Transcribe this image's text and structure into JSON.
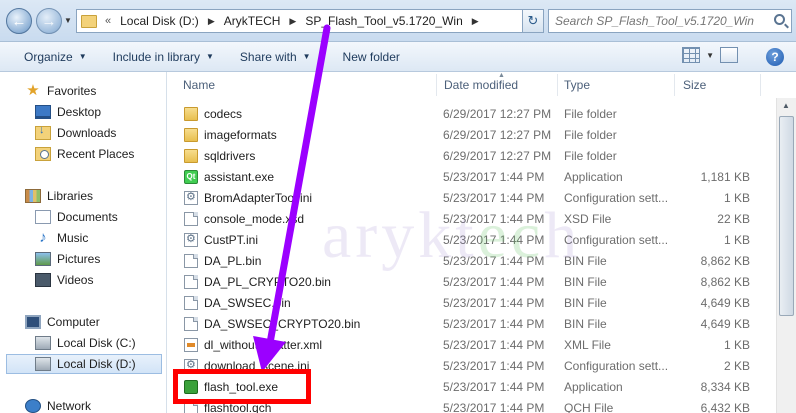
{
  "address": {
    "chevron": "«",
    "crumbs": [
      "Local Disk (D:)",
      "ArykTECH",
      "SP_Flash_Tool_v5.1720_Win"
    ]
  },
  "search": {
    "placeholder": "Search SP_Flash_Tool_v5.1720_Win"
  },
  "toolbar": {
    "organize": "Organize",
    "include": "Include in library",
    "share": "Share with",
    "new_folder": "New folder",
    "help": "?"
  },
  "nav": {
    "favorites": "Favorites",
    "desktop": "Desktop",
    "downloads": "Downloads",
    "recent": "Recent Places",
    "libraries": "Libraries",
    "documents": "Documents",
    "music": "Music",
    "pictures": "Pictures",
    "videos": "Videos",
    "computer": "Computer",
    "local_c": "Local Disk (C:)",
    "local_d": "Local Disk (D:)",
    "network": "Network"
  },
  "columns": {
    "name": "Name",
    "date": "Date modified",
    "type": "Type",
    "size": "Size"
  },
  "files": [
    {
      "name": "codecs",
      "date": "6/29/2017 12:27 PM",
      "type": "File folder",
      "size": "",
      "icon": "folder"
    },
    {
      "name": "imageformats",
      "date": "6/29/2017 12:27 PM",
      "type": "File folder",
      "size": "",
      "icon": "folder"
    },
    {
      "name": "sqldrivers",
      "date": "6/29/2017 12:27 PM",
      "type": "File folder",
      "size": "",
      "icon": "folder"
    },
    {
      "name": "assistant.exe",
      "date": "5/23/2017 1:44 PM",
      "type": "Application",
      "size": "1,181 KB",
      "icon": "qt"
    },
    {
      "name": "BromAdapterTool.ini",
      "date": "5/23/2017 1:44 PM",
      "type": "Configuration sett...",
      "size": "1 KB",
      "icon": "gear"
    },
    {
      "name": "console_mode.xsd",
      "date": "5/23/2017 1:44 PM",
      "type": "XSD File",
      "size": "22 KB",
      "icon": "doc"
    },
    {
      "name": "CustPT.ini",
      "date": "5/23/2017 1:44 PM",
      "type": "Configuration sett...",
      "size": "1 KB",
      "icon": "gear"
    },
    {
      "name": "DA_PL.bin",
      "date": "5/23/2017 1:44 PM",
      "type": "BIN File",
      "size": "8,862 KB",
      "icon": "doc"
    },
    {
      "name": "DA_PL_CRYPTO20.bin",
      "date": "5/23/2017 1:44 PM",
      "type": "BIN File",
      "size": "8,862 KB",
      "icon": "doc"
    },
    {
      "name": "DA_SWSEC.bin",
      "date": "5/23/2017 1:44 PM",
      "type": "BIN File",
      "size": "4,649 KB",
      "icon": "doc"
    },
    {
      "name": "DA_SWSEC_CRYPTO20.bin",
      "date": "5/23/2017 1:44 PM",
      "type": "BIN File",
      "size": "4,649 KB",
      "icon": "doc"
    },
    {
      "name": "dl_without_scatter.xml",
      "date": "5/23/2017 1:44 PM",
      "type": "XML File",
      "size": "1 KB",
      "icon": "xml"
    },
    {
      "name": "download_scene.ini",
      "date": "5/23/2017 1:44 PM",
      "type": "Configuration sett...",
      "size": "2 KB",
      "icon": "gear"
    },
    {
      "name": "flash_tool.exe",
      "date": "5/23/2017 1:44 PM",
      "type": "Application",
      "size": "8,334 KB",
      "icon": "app"
    },
    {
      "name": "flashtool.qch",
      "date": "5/23/2017 1:44 PM",
      "type": "QCH File",
      "size": "6,432 KB",
      "icon": "doc"
    }
  ],
  "watermark": {
    "text_a": "arykt",
    "text_b": "ec",
    "text_c": "h"
  },
  "colors": {
    "arrow": "#9b00ff",
    "highlight": "#ff0000"
  }
}
